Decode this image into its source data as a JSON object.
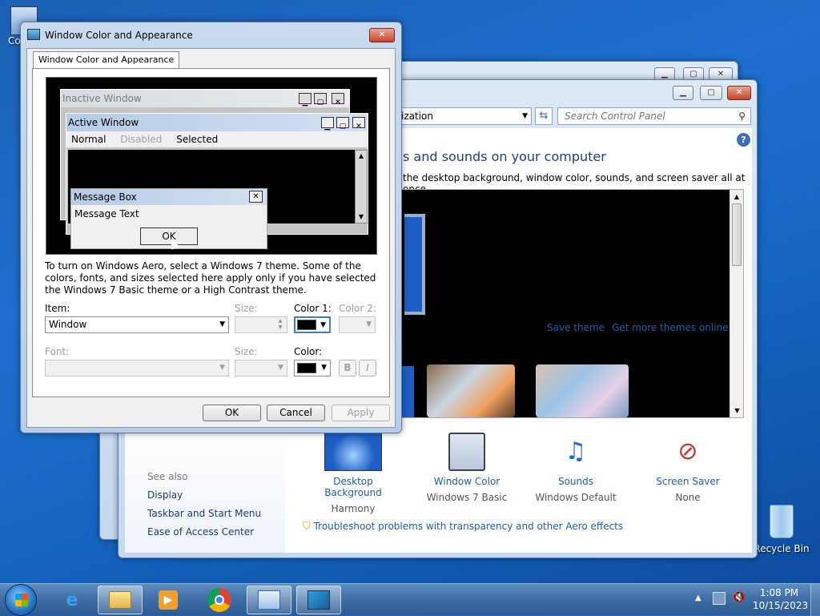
{
  "desktop": {
    "computer_label": "Co",
    "recycle_bin_label": "Recycle Bin"
  },
  "control_panel": {
    "search_placeholder": "Search Control Panel",
    "address_tail": "ization",
    "heading": "s and sounds on your computer",
    "subheading": "the desktop background, window color, sounds, and screen saver all at once.",
    "save_theme": "Save theme",
    "get_more_themes": "Get more themes online",
    "see_also_title": "See also",
    "see_also_items": [
      "Display",
      "Taskbar and Start Menu",
      "Ease of Access Center"
    ],
    "bottom_items": [
      {
        "label": "Desktop Background",
        "sub": "Harmony"
      },
      {
        "label": "Window Color",
        "sub": "Windows 7 Basic"
      },
      {
        "label": "Sounds",
        "sub": "Windows Default"
      },
      {
        "label": "Screen Saver",
        "sub": "None"
      }
    ],
    "troubleshoot": "Troubleshoot problems with transparency and other Aero effects"
  },
  "dialog": {
    "title": "Window Color and Appearance",
    "tab": "Window Color and Appearance",
    "preview": {
      "inactive_title": "Inactive Window",
      "active_title": "Active Window",
      "menu_normal": "Normal",
      "menu_disabled": "Disabled",
      "menu_selected": "Selected",
      "msgbox_title": "Message Box",
      "msgbox_text": "Message Text",
      "msgbox_ok": "OK"
    },
    "info_text": "To turn on Windows Aero, select a Windows 7 theme.  Some of the colors, fonts, and sizes selected here apply only if you have selected the Windows 7 Basic theme or a High Contrast theme.",
    "item_label": "Item:",
    "item_value": "Window",
    "size_label": "Size:",
    "color1_label": "Color 1:",
    "color2_label": "Color 2:",
    "font_label": "Font:",
    "font_size_label": "Size:",
    "color_label": "Color:",
    "bold_label": "B",
    "italic_label": "I",
    "ok": "OK",
    "cancel": "Cancel",
    "apply": "Apply",
    "color1_swatch": "#000000",
    "font_color_swatch": "#000000"
  },
  "taskbar": {
    "time": "1:08 PM",
    "date": "10/15/2023"
  }
}
